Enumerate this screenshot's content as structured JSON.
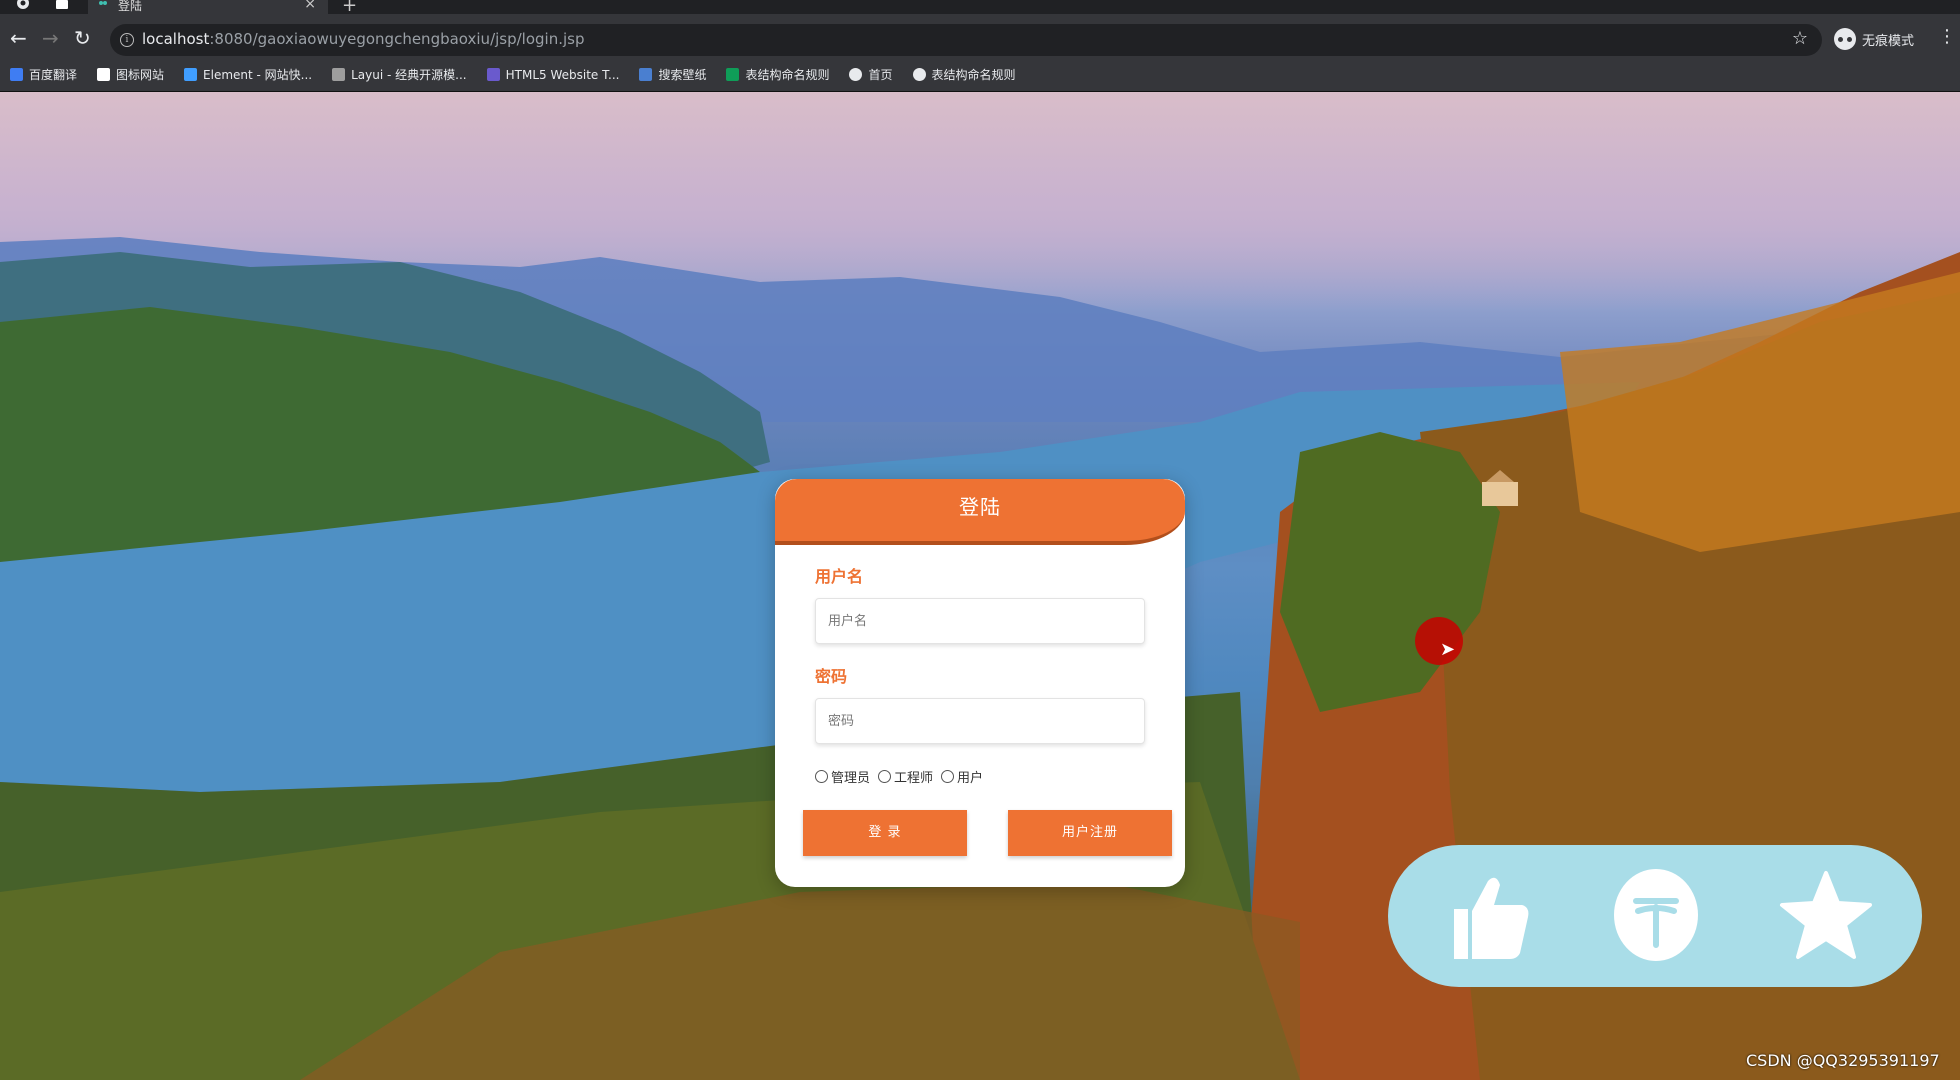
{
  "browser": {
    "tab_title": "登陆",
    "tab_close": "×",
    "new_tab": "+",
    "url_host": "localhost",
    "url_rest": ":8080/gaoxiaowuyegongchengbaoxiu/jsp/login.jsp",
    "incognito_label": "无痕模式",
    "back": "←",
    "forward": "→",
    "reload": "↻",
    "star": "☆",
    "menu": "⋮"
  },
  "bookmarks": [
    {
      "label": "百度翻译",
      "icon": "baidu-translate-icon",
      "color": "#3f7df3"
    },
    {
      "label": "图标网站",
      "icon": "flag-icon",
      "color": "#ffffff"
    },
    {
      "label": "Element - 网站快...",
      "icon": "element-icon",
      "color": "#409eff"
    },
    {
      "label": "Layui - 经典开源模...",
      "icon": "layui-icon",
      "color": "#9e9e9e"
    },
    {
      "label": "HTML5 Website T...",
      "icon": "html5-icon",
      "color": "#6a5acd"
    },
    {
      "label": "搜索壁纸",
      "icon": "wallpaper-icon",
      "color": "#4a7fd0"
    },
    {
      "label": "表结构命名规则",
      "icon": "sheet-icon",
      "color": "#0f9d58"
    },
    {
      "label": "首页",
      "icon": "globe-icon",
      "color": "#e8eaed"
    },
    {
      "label": "表结构命名规则",
      "icon": "globe-icon",
      "color": "#e8eaed"
    }
  ],
  "login": {
    "title": "登陆",
    "username_label": "用户名",
    "username_placeholder": "用户名",
    "password_label": "密码",
    "password_placeholder": "密码",
    "roles": [
      "管理员",
      "工程师",
      "用户"
    ],
    "login_button": "登 录",
    "register_button": "用户注册"
  },
  "overlay": {
    "watermark": "CSDN @QQ3295391197",
    "actions": [
      "thumbs-up-icon",
      "coin-icon",
      "star-icon"
    ]
  },
  "colors": {
    "accent": "#ee7233",
    "pill": "#a9dde8"
  }
}
